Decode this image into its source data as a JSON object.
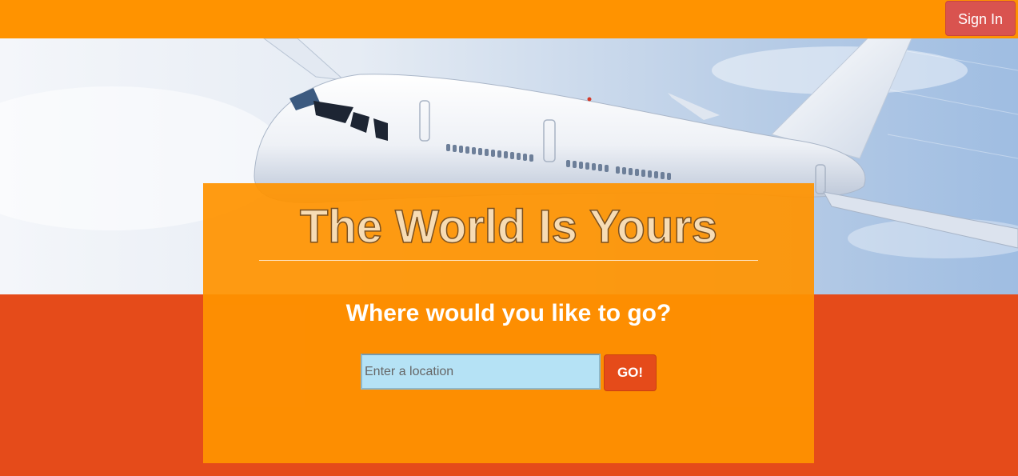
{
  "topbar": {
    "signin_label": "Sign In"
  },
  "hero": {
    "image": "airplane-photo"
  },
  "panel": {
    "title": "The World Is Yours",
    "subtitle": "Where would you like to go?",
    "search": {
      "placeholder": "Enter a location",
      "value": "",
      "button_label": "GO!"
    }
  },
  "colors": {
    "topbar": "#ff9300",
    "panel": "#ff9300",
    "background": "#e54b1a",
    "signin_button": "#d9534f",
    "go_button": "#e54b1a",
    "input_background": "#b5e2f5"
  }
}
